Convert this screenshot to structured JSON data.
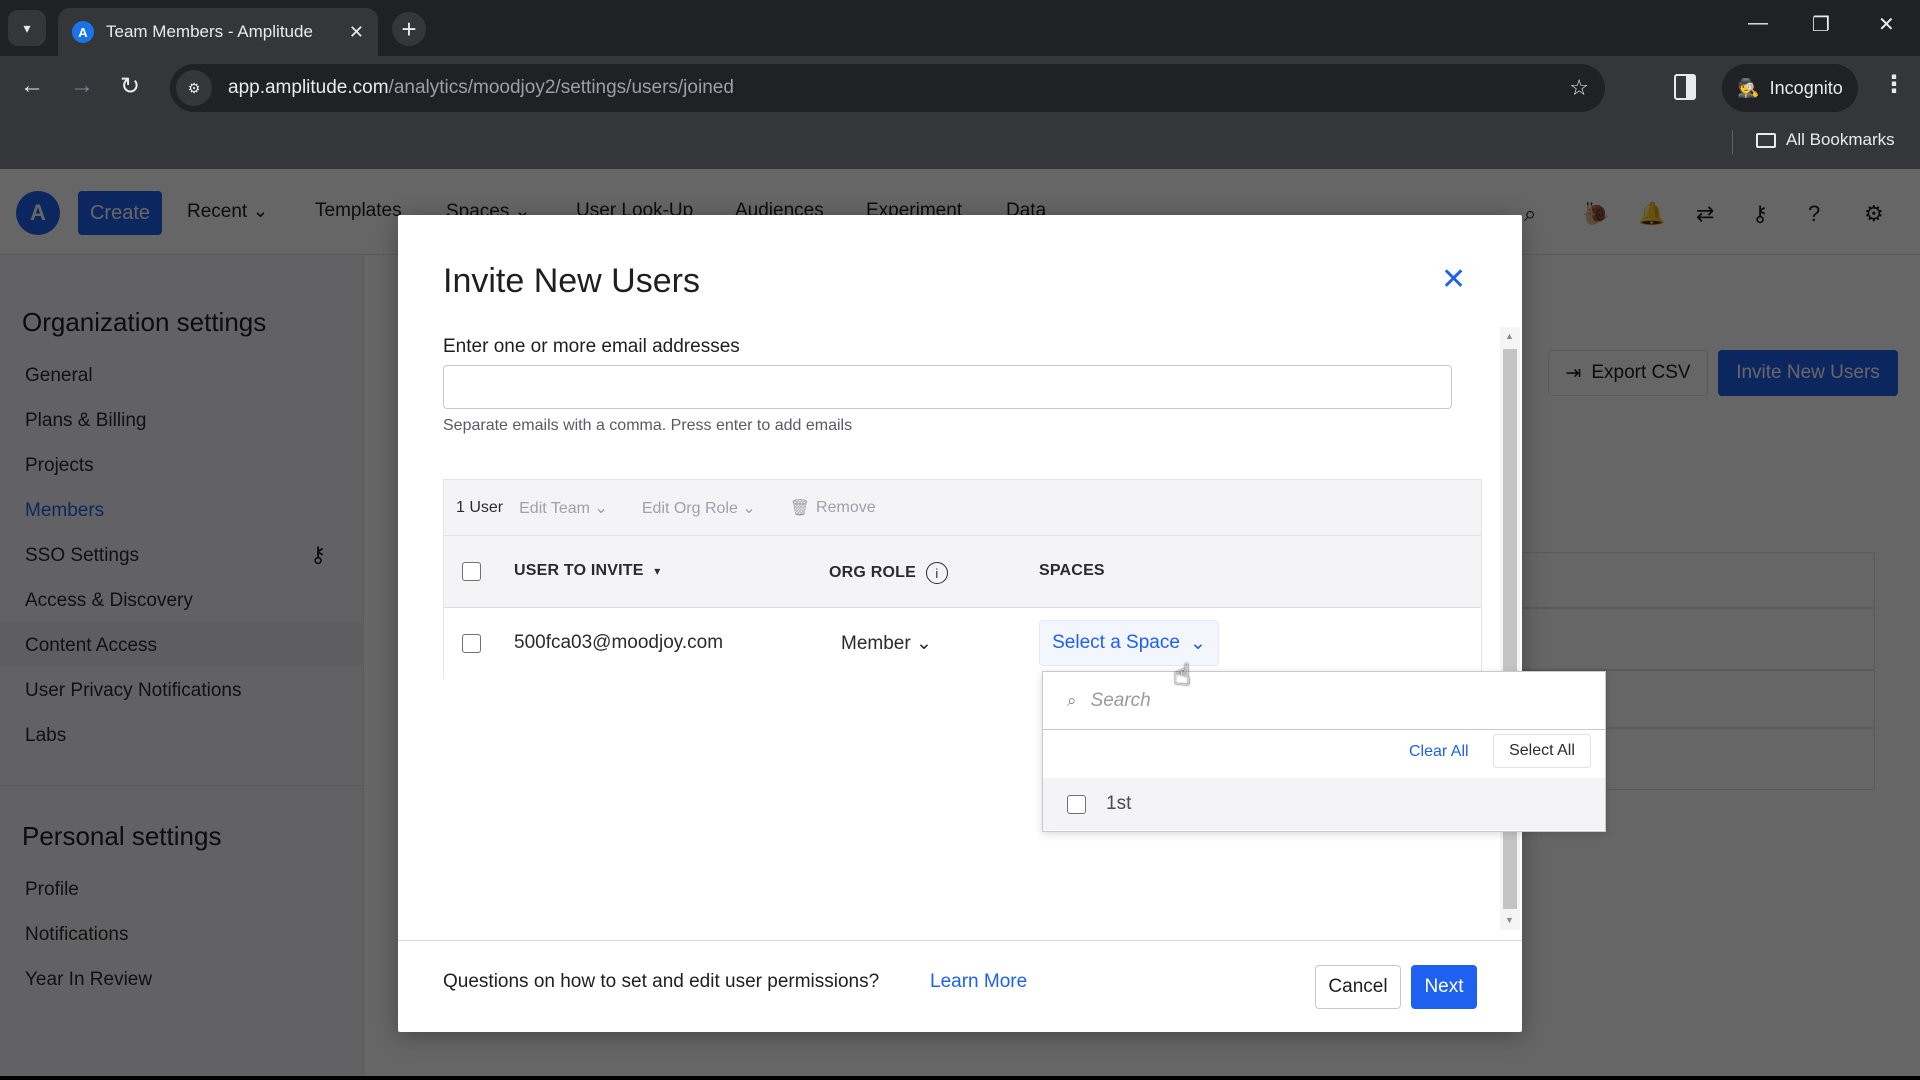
{
  "browser": {
    "tab_title": "Team Members - Amplitude",
    "tab_favicon": "A",
    "url_host": "app.amplitude.com",
    "url_path": "/analytics/moodjoy2/settings/users/joined",
    "incognito_label": "Incognito",
    "bookmarks_label": "All Bookmarks",
    "icons": {
      "tab_search": "▾",
      "tab_close": "✕",
      "new_tab": "+",
      "minimize": "—",
      "restore": "❐",
      "window_close": "✕",
      "back": "←",
      "forward": "→",
      "reload": "↻",
      "site_info": "⚙",
      "star": "☆",
      "incognito": "🕵",
      "menu": "⋮"
    }
  },
  "app": {
    "logo": "A",
    "create_label": "Create",
    "nav": [
      {
        "label": "Recent ⌄"
      },
      {
        "label": "Templates"
      },
      {
        "label": "Spaces ⌄"
      },
      {
        "label": "User Look-Up"
      },
      {
        "label": "Audiences"
      },
      {
        "label": "Experiment"
      },
      {
        "label": "Data"
      }
    ],
    "top_icons": {
      "search": "⌕",
      "snail": "🐌",
      "bell": "🔔",
      "sync": "⇄",
      "key": "⚷",
      "help": "?",
      "settings": "⚙"
    },
    "sidebar": {
      "org_heading": "Organization settings",
      "org_items": [
        {
          "label": "General"
        },
        {
          "label": "Plans & Billing"
        },
        {
          "label": "Projects"
        },
        {
          "label": "Members",
          "active": true
        },
        {
          "label": "SSO Settings"
        },
        {
          "label": "Access & Discovery"
        },
        {
          "label": "Content Access"
        },
        {
          "label": "User Privacy Notifications"
        },
        {
          "label": "Labs"
        }
      ],
      "personal_heading": "Personal settings",
      "personal_items": [
        {
          "label": "Profile"
        },
        {
          "label": "Notifications"
        },
        {
          "label": "Year In Review"
        }
      ],
      "sso_key_icon": "⚷"
    },
    "export_csv_label": "Export CSV",
    "export_icon": "⇥",
    "invite_new_users_label": "Invite New Users"
  },
  "modal": {
    "title": "Invite New Users",
    "close_icon": "✕",
    "email_label": "Enter one or more email addresses",
    "email_value": "",
    "email_help": "Separate emails with a comma. Press enter to add emails",
    "bulk": {
      "count": "1 User",
      "edit_team": "Edit Team ⌄",
      "edit_org_role": "Edit Org Role ⌄",
      "remove": "Remove",
      "trash_icon": "🗑"
    },
    "columns": {
      "user": "USER TO INVITE",
      "user_sort_icon": "▾",
      "org_role": "ORG ROLE",
      "info_icon": "i",
      "spaces": "SPACES"
    },
    "rows": [
      {
        "email": "500fca03@moodjoy.com",
        "role": "Member",
        "space_placeholder": "Select a Space",
        "checked": false
      }
    ],
    "chevron": "⌄",
    "footer": {
      "question": "Questions on how to set and edit user permissions?",
      "learn_more": "Learn More",
      "cancel": "Cancel",
      "next": "Next"
    },
    "scroll_up": "▲",
    "scroll_down": "▼"
  },
  "space_dropdown": {
    "search_placeholder": "Search",
    "search_icon": "⌕",
    "clear_all": "Clear All",
    "select_all": "Select All",
    "options": [
      {
        "label": "1st",
        "checked": false
      }
    ]
  },
  "cursor_icon": "☝",
  "colors": {
    "accent": "#1e61f0",
    "overlay": "rgba(0,0,0,0.6)"
  }
}
